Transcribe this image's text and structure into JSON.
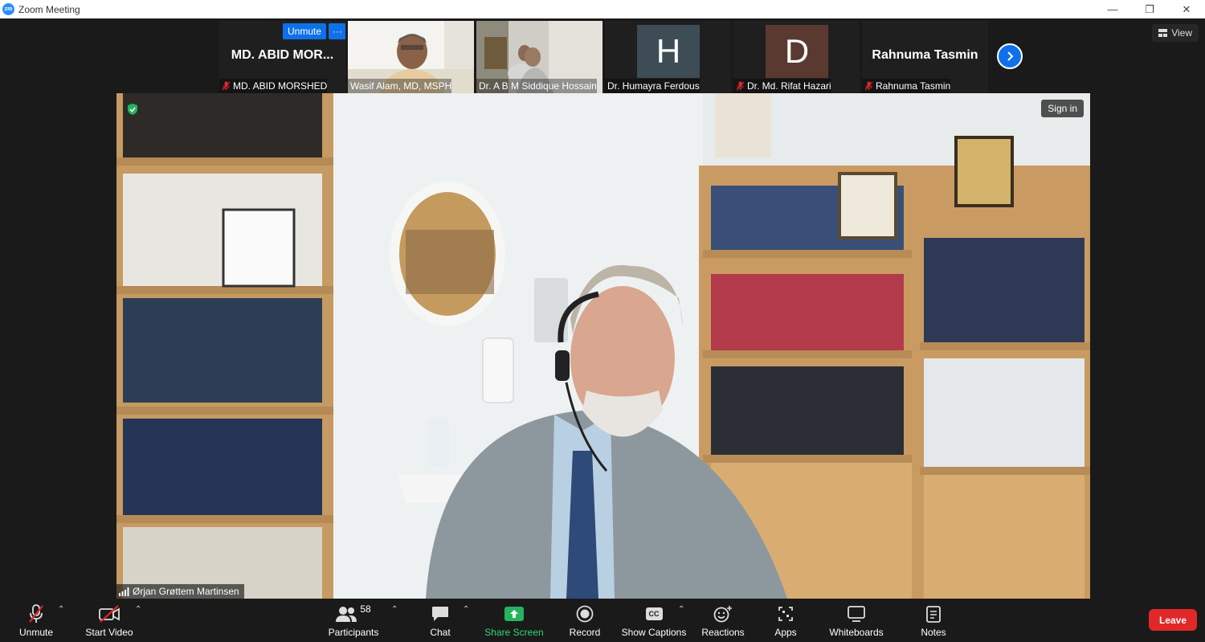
{
  "window": {
    "title": "Zoom Meeting",
    "logo_text": "zm",
    "minimize": "—",
    "restore": "❐",
    "close": "✕"
  },
  "view_button": {
    "label": "View"
  },
  "thumbnails": [
    {
      "big_name": "MD. ABID MOR...",
      "label": "MD. ABID MORSHED",
      "muted": true,
      "unmute_label": "Unmute",
      "more_label": "···"
    },
    {
      "label": "Wasif Alam, MD, MSPH",
      "muted": false
    },
    {
      "label": "Dr. A B M Siddique Hossain",
      "muted": false
    },
    {
      "avatar_letter": "H",
      "avatar_color": "#3e4c55",
      "label": "Dr. Humayra Ferdous",
      "muted": false
    },
    {
      "avatar_letter": "D",
      "avatar_color": "#5a3a30",
      "label": "Dr. Md. Rifat Hazari",
      "muted": true
    },
    {
      "big_name": "Rahnuma Tasmin",
      "label": "Rahnuma Tasmin",
      "muted": true
    }
  ],
  "video": {
    "sign_in": "Sign in",
    "speaker_name": "Ørjan Grøttem Martinsen"
  },
  "toolbar": {
    "unmute": "Unmute",
    "start_video": "Start Video",
    "participants": "Participants",
    "participants_count": "58",
    "chat": "Chat",
    "share_screen": "Share Screen",
    "record": "Record",
    "show_captions": "Show Captions",
    "captions_badge": "CC",
    "reactions": "Reactions",
    "apps": "Apps",
    "whiteboards": "Whiteboards",
    "notes": "Notes",
    "leave": "Leave"
  },
  "colors": {
    "accent": "#0e71eb",
    "share_green": "#23b45d",
    "leave_red": "#e02828",
    "mute_red": "#e02828"
  }
}
